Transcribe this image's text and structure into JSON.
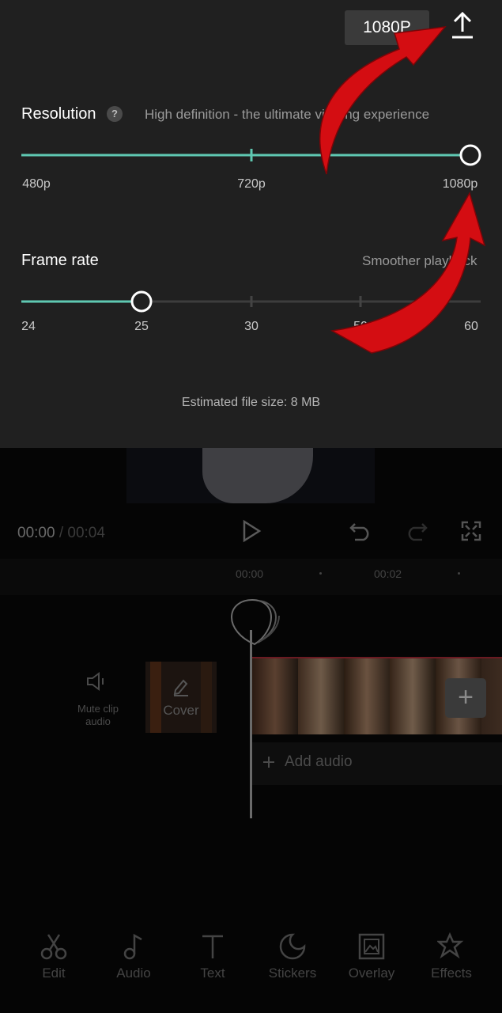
{
  "header": {
    "resolution_badge": "1080P",
    "export_icon": "upload-icon"
  },
  "resolution": {
    "label": "Resolution",
    "help_icon": "?",
    "description": "High definition - the ultimate viewing experience",
    "ticks": [
      "480p",
      "720p",
      "1080p"
    ],
    "selected": "1080p",
    "selected_fraction": 1.0
  },
  "frame_rate": {
    "label": "Frame rate",
    "description": "Smoother playback",
    "ticks": [
      "24",
      "25",
      "30",
      "50",
      "60"
    ],
    "selected": "25",
    "selected_fraction": 0.25
  },
  "estimated_size": "Estimated file size: 8 MB",
  "player": {
    "current_time": "00:00",
    "separator": " / ",
    "total_time": "00:04"
  },
  "timeline": {
    "ruler_labels": [
      "00:00",
      "00:02"
    ],
    "mute_label": "Mute clip audio",
    "cover_label": "Cover",
    "add_audio": "Add audio",
    "add_clip": "+"
  },
  "toolbar": {
    "items": [
      {
        "label": "Edit",
        "icon": "scissors-icon"
      },
      {
        "label": "Audio",
        "icon": "music-note-icon"
      },
      {
        "label": "Text",
        "icon": "text-icon"
      },
      {
        "label": "Stickers",
        "icon": "sticker-icon"
      },
      {
        "label": "Overlay",
        "icon": "overlay-icon"
      },
      {
        "label": "Effects",
        "icon": "effects-star-icon"
      }
    ]
  },
  "colors": {
    "slider_accent": "#5fc8b2",
    "annotation_arrow": "#d40d12"
  }
}
